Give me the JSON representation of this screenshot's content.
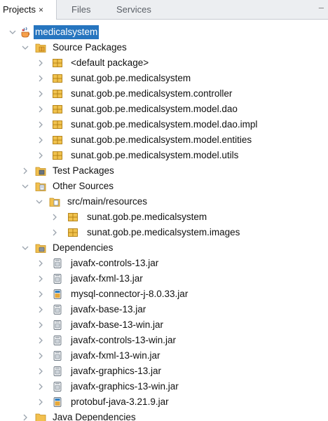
{
  "tabs": [
    {
      "label": "Projects",
      "close": "×"
    },
    {
      "label": "Files"
    },
    {
      "label": "Services"
    }
  ],
  "minimize_glyph": "–",
  "tree": {
    "project": "medicalsystem",
    "source_packages": {
      "label": "Source Packages",
      "items": [
        "<default package>",
        "sunat.gob.pe.medicalsystem",
        "sunat.gob.pe.medicalsystem.controller",
        "sunat.gob.pe.medicalsystem.model.dao",
        "sunat.gob.pe.medicalsystem.model.dao.impl",
        "sunat.gob.pe.medicalsystem.model.entities",
        "sunat.gob.pe.medicalsystem.model.utils"
      ]
    },
    "test_packages": "Test Packages",
    "other_sources": {
      "label": "Other Sources",
      "folder": "src/main/resources",
      "items": [
        "sunat.gob.pe.medicalsystem",
        "sunat.gob.pe.medicalsystem.images"
      ]
    },
    "dependencies": {
      "label": "Dependencies",
      "items": [
        "javafx-controls-13.jar",
        "javafx-fxml-13.jar",
        "mysql-connector-j-8.0.33.jar",
        "javafx-base-13.jar",
        "javafx-base-13-win.jar",
        "javafx-controls-13-win.jar",
        "javafx-fxml-13-win.jar",
        "javafx-graphics-13.jar",
        "javafx-graphics-13-win.jar",
        "protobuf-java-3.21.9.jar"
      ]
    },
    "java_dependencies": "Java Dependencies"
  },
  "colors": {
    "selection": "#2675bf",
    "package": "#e8b64a",
    "folder": "#f2c04f",
    "jar": "#7d8a96"
  }
}
